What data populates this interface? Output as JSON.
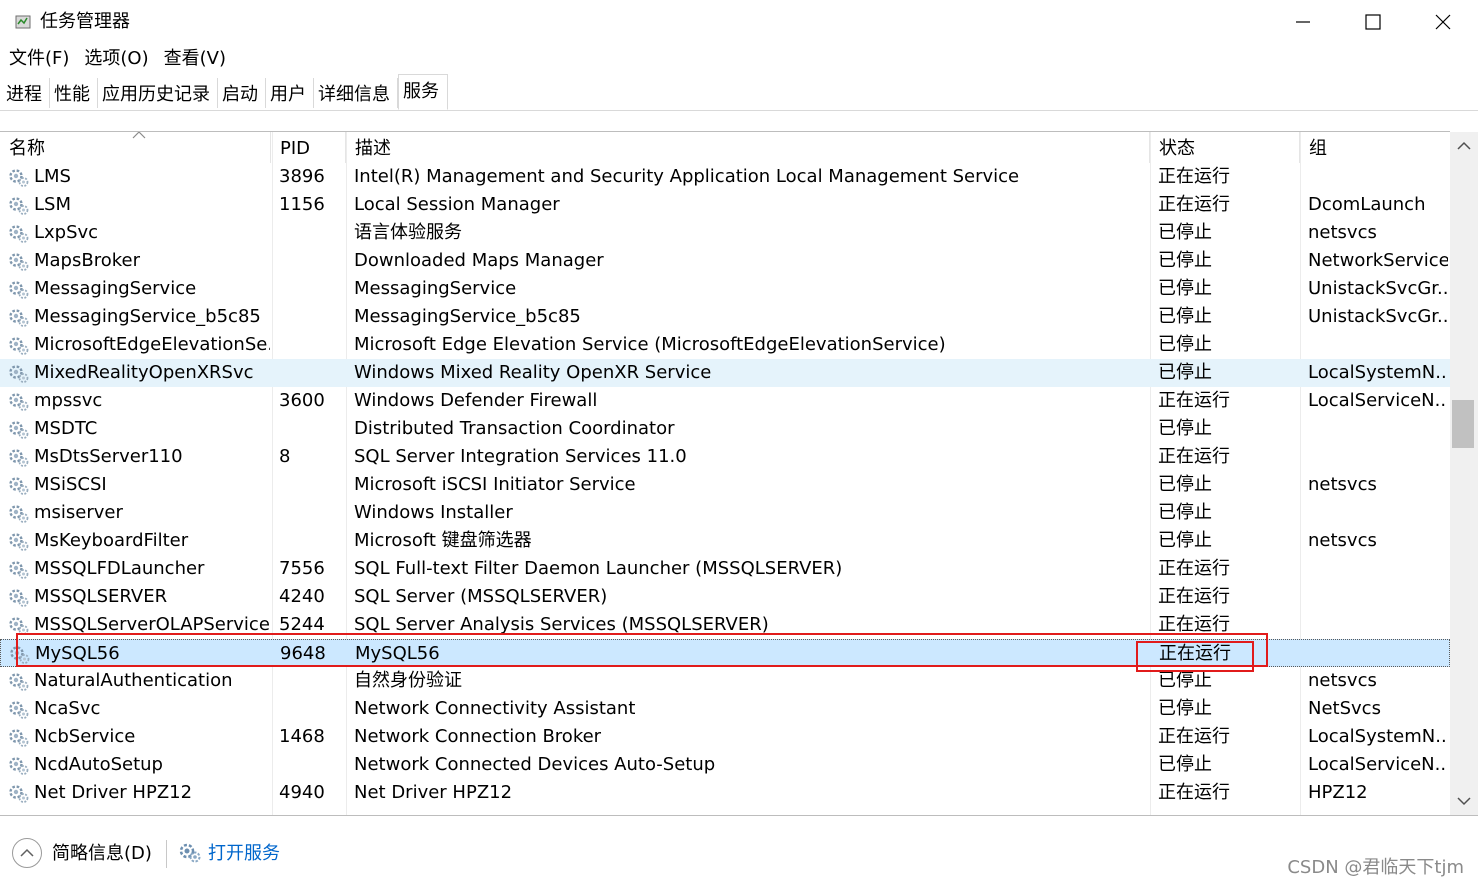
{
  "window": {
    "title": "任务管理器",
    "minimize_icon": "minimize-icon",
    "maximize_icon": "maximize-icon",
    "close_icon": "close-icon"
  },
  "menu": [
    "文件(F)",
    "选项(O)",
    "查看(V)"
  ],
  "tabs": [
    {
      "label": "进程",
      "active": false
    },
    {
      "label": "性能",
      "active": false
    },
    {
      "label": "应用历史记录",
      "active": false
    },
    {
      "label": "启动",
      "active": false
    },
    {
      "label": "用户",
      "active": false
    },
    {
      "label": "详细信息",
      "active": false
    },
    {
      "label": "服务",
      "active": true
    }
  ],
  "columns": [
    "名称",
    "PID",
    "描述",
    "状态",
    "组"
  ],
  "rows": [
    {
      "name": "LMS",
      "pid": "3896",
      "desc": "Intel(R) Management and Security Application Local Management Service",
      "status": "正在运行",
      "group": ""
    },
    {
      "name": "LSM",
      "pid": "1156",
      "desc": "Local Session Manager",
      "status": "正在运行",
      "group": "DcomLaunch"
    },
    {
      "name": "LxpSvc",
      "pid": "",
      "desc": "语言体验服务",
      "status": "已停止",
      "group": "netsvcs"
    },
    {
      "name": "MapsBroker",
      "pid": "",
      "desc": "Downloaded Maps Manager",
      "status": "已停止",
      "group": "NetworkService"
    },
    {
      "name": "MessagingService",
      "pid": "",
      "desc": "MessagingService",
      "status": "已停止",
      "group": "UnistackSvcGr..."
    },
    {
      "name": "MessagingService_b5c85",
      "pid": "",
      "desc": "MessagingService_b5c85",
      "status": "已停止",
      "group": "UnistackSvcGr..."
    },
    {
      "name": "MicrosoftEdgeElevationSe...",
      "pid": "",
      "desc": "Microsoft Edge Elevation Service (MicrosoftEdgeElevationService)",
      "status": "已停止",
      "group": ""
    },
    {
      "name": "MixedRealityOpenXRSvc",
      "pid": "",
      "desc": "Windows Mixed Reality OpenXR Service",
      "status": "已停止",
      "group": "LocalSystemN...",
      "hover": true
    },
    {
      "name": "mpssvc",
      "pid": "3600",
      "desc": "Windows Defender Firewall",
      "status": "正在运行",
      "group": "LocalServiceN..."
    },
    {
      "name": "MSDTC",
      "pid": "",
      "desc": "Distributed Transaction Coordinator",
      "status": "已停止",
      "group": ""
    },
    {
      "name": "MsDtsServer110",
      "pid": "8",
      "desc": "SQL Server Integration Services 11.0",
      "status": "正在运行",
      "group": ""
    },
    {
      "name": "MSiSCSI",
      "pid": "",
      "desc": "Microsoft iSCSI Initiator Service",
      "status": "已停止",
      "group": "netsvcs"
    },
    {
      "name": "msiserver",
      "pid": "",
      "desc": "Windows Installer",
      "status": "已停止",
      "group": ""
    },
    {
      "name": "MsKeyboardFilter",
      "pid": "",
      "desc": "Microsoft 键盘筛选器",
      "status": "已停止",
      "group": "netsvcs"
    },
    {
      "name": "MSSQLFDLauncher",
      "pid": "7556",
      "desc": "SQL Full-text Filter Daemon Launcher (MSSQLSERVER)",
      "status": "正在运行",
      "group": ""
    },
    {
      "name": "MSSQLSERVER",
      "pid": "4240",
      "desc": "SQL Server (MSSQLSERVER)",
      "status": "正在运行",
      "group": ""
    },
    {
      "name": "MSSQLServerOLAPService",
      "pid": "5244",
      "desc": "SQL Server Analysis Services (MSSQLSERVER)",
      "status": "正在运行",
      "group": ""
    },
    {
      "name": "MySQL56",
      "pid": "9648",
      "desc": "MySQL56",
      "status": "正在运行",
      "group": "",
      "selected": true
    },
    {
      "name": "NaturalAuthentication",
      "pid": "",
      "desc": "自然身份验证",
      "status": "已停止",
      "group": "netsvcs"
    },
    {
      "name": "NcaSvc",
      "pid": "",
      "desc": "Network Connectivity Assistant",
      "status": "已停止",
      "group": "NetSvcs"
    },
    {
      "name": "NcbService",
      "pid": "1468",
      "desc": "Network Connection Broker",
      "status": "正在运行",
      "group": "LocalSystemN..."
    },
    {
      "name": "NcdAutoSetup",
      "pid": "",
      "desc": "Network Connected Devices Auto-Setup",
      "status": "已停止",
      "group": "LocalServiceN..."
    },
    {
      "name": "Net Driver HPZ12",
      "pid": "4940",
      "desc": "Net Driver HPZ12",
      "status": "正在运行",
      "group": "HPZ12"
    }
  ],
  "footer": {
    "fewer_details": "简略信息(D)",
    "open_services": "打开服务",
    "watermark": "CSDN @君临天下tjm"
  }
}
